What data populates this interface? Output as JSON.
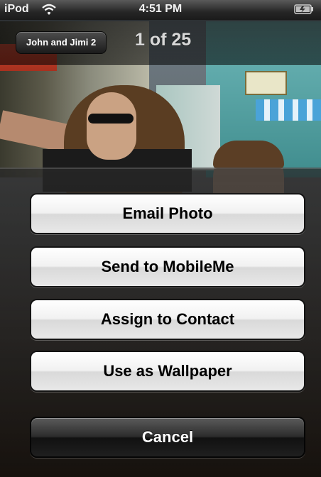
{
  "status_bar": {
    "carrier": "iPod",
    "time": "4:51 PM",
    "wifi_icon": "wifi-icon",
    "battery_icon": "battery-icon"
  },
  "nav_bar": {
    "back_label": "John and Jimi 2",
    "title": "1 of 25"
  },
  "action_sheet": {
    "buttons": [
      {
        "label": "Email Photo"
      },
      {
        "label": "Send to MobileMe"
      },
      {
        "label": "Assign to Contact"
      },
      {
        "label": "Use as Wallpaper"
      }
    ],
    "cancel_label": "Cancel"
  },
  "colors": {
    "sheet_button_bg": "#f1f1f1",
    "cancel_button_bg": "#1f1f1f",
    "navbar_bg": "#1a1a1a"
  }
}
